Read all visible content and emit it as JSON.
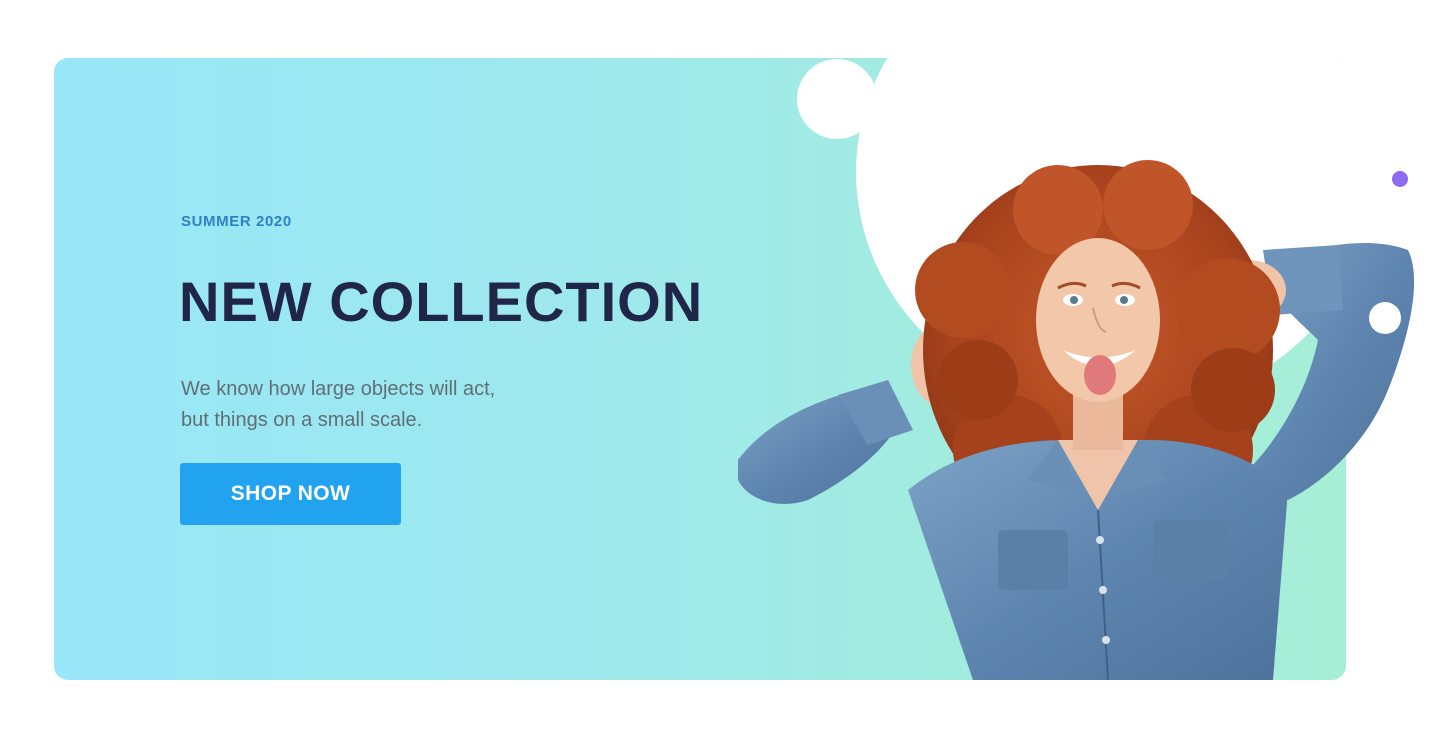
{
  "banner": {
    "subtitle": "SUMMER 2020",
    "headline": "NEW COLLECTION",
    "description_lines": [
      "We know how large objects will act,",
      "but things on a small scale."
    ],
    "cta_label": "SHOP NOW"
  },
  "colors": {
    "gradient_start": "#98e6f8",
    "gradient_end": "#a6eed6",
    "headline": "#202648",
    "subtitle": "#2f80c7",
    "description": "#5f6f75",
    "cta_background": "#22a3ef",
    "cta_text": "#ffffff",
    "accent_dot": "#8d6cf2"
  },
  "hero_image": {
    "subject": "woman-with-curly-red-hair-in-denim-shirt"
  }
}
